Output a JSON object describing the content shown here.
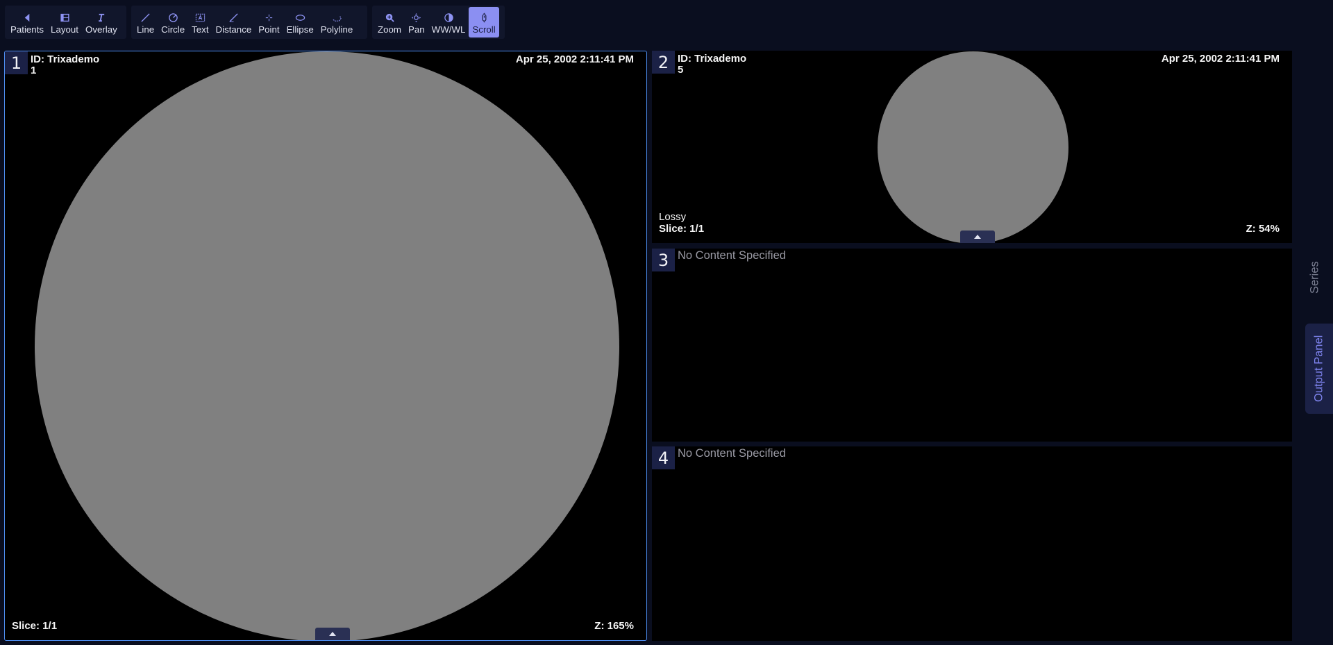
{
  "toolbar": {
    "group1": [
      {
        "label": "Patients",
        "icon": "chevron-left-icon"
      },
      {
        "label": "Layout",
        "icon": "layout-grid-icon"
      },
      {
        "label": "Overlay",
        "icon": "text-italic-icon"
      }
    ],
    "group2": [
      {
        "label": "Line",
        "icon": "line-icon"
      },
      {
        "label": "Circle",
        "icon": "circle-icon"
      },
      {
        "label": "Text",
        "icon": "text-box-icon"
      },
      {
        "label": "Distance",
        "icon": "distance-icon"
      },
      {
        "label": "Point",
        "icon": "point-icon"
      },
      {
        "label": "Ellipse",
        "icon": "ellipse-icon"
      },
      {
        "label": "Polyline",
        "icon": "polyline-icon"
      }
    ],
    "group3": [
      {
        "label": "Zoom",
        "icon": "zoom-icon"
      },
      {
        "label": "Pan",
        "icon": "pan-icon"
      },
      {
        "label": "WW/WL",
        "icon": "contrast-icon"
      },
      {
        "label": "Scroll",
        "icon": "scroll-icon",
        "active": true
      }
    ]
  },
  "viewports": [
    {
      "number": "1",
      "id_line": "ID: Trixademo",
      "sub_line": "1",
      "date": "Apr 25, 2002 2:11:41 PM",
      "slice": "Slice: 1/1",
      "zoom": "Z: 165%"
    },
    {
      "number": "2",
      "id_line": "ID: Trixademo",
      "sub_line": "5",
      "date": "Apr 25, 2002 2:11:41 PM",
      "compression": "Lossy",
      "slice": "Slice: 1/1",
      "zoom": "Z: 54%"
    },
    {
      "number": "3",
      "message": "No Content Specified"
    },
    {
      "number": "4",
      "message": "No Content Specified"
    }
  ],
  "sidebar": {
    "series_label": "Series",
    "output_label": "Output Panel"
  },
  "colors": {
    "background": "#0a0e1f",
    "toolbar_group": "#11162b",
    "active_tool": "#8b8ff2",
    "active_viewport_border": "#4d8df0",
    "image_gray": "#808080"
  }
}
